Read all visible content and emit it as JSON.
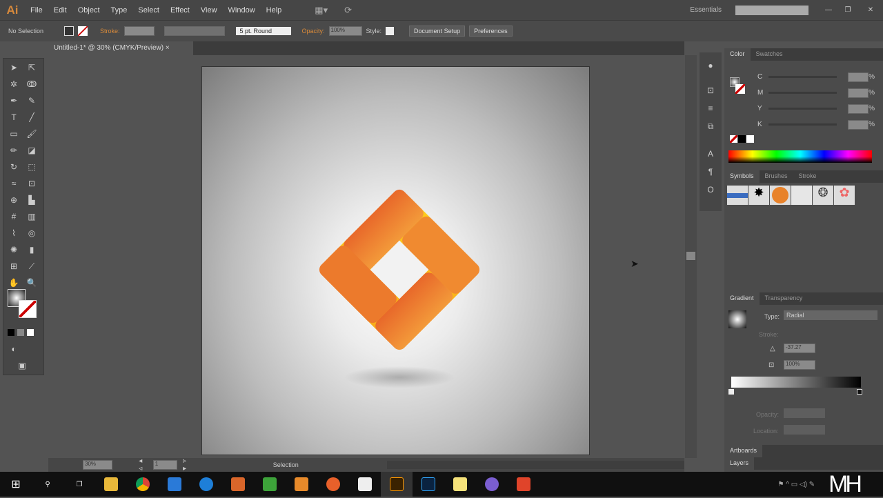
{
  "app": {
    "logo": "Ai",
    "menu": [
      "File",
      "Edit",
      "Object",
      "Type",
      "Select",
      "Effect",
      "View",
      "Window",
      "Help"
    ],
    "workspace": "Essentials"
  },
  "control": {
    "selection": "No Selection",
    "stroke_label": "Stroke:",
    "brush": "5 pt. Round",
    "opacity_label": "Opacity:",
    "opacity": "100%",
    "style_label": "Style:",
    "doc_setup": "Document Setup",
    "preferences": "Preferences"
  },
  "document": {
    "tab": "Untitled-1* @ 30% (CMYK/Preview)"
  },
  "color_panel": {
    "tabs": [
      "Color",
      "Swatches"
    ],
    "channels": [
      "C",
      "M",
      "Y",
      "K"
    ],
    "unit": "%"
  },
  "symbols_panel": {
    "tabs": [
      "Symbols",
      "Brushes",
      "Stroke"
    ]
  },
  "gradient_panel": {
    "tabs": [
      "Gradient",
      "Transparency"
    ],
    "type_label": "Type:",
    "type": "Radial",
    "stroke_label": "Stroke:",
    "angle": "-37.27",
    "aspect": "100%",
    "opacity_label": "Opacity:",
    "location_label": "Location:"
  },
  "bottom_panels": {
    "artboards": "Artboards",
    "layers": "Layers"
  },
  "status": {
    "zoom": "30%",
    "artboard": "1",
    "tool": "Selection"
  },
  "watermark": "MH",
  "colors": {
    "accent": "#d98a3a",
    "canvas": "#535353"
  }
}
